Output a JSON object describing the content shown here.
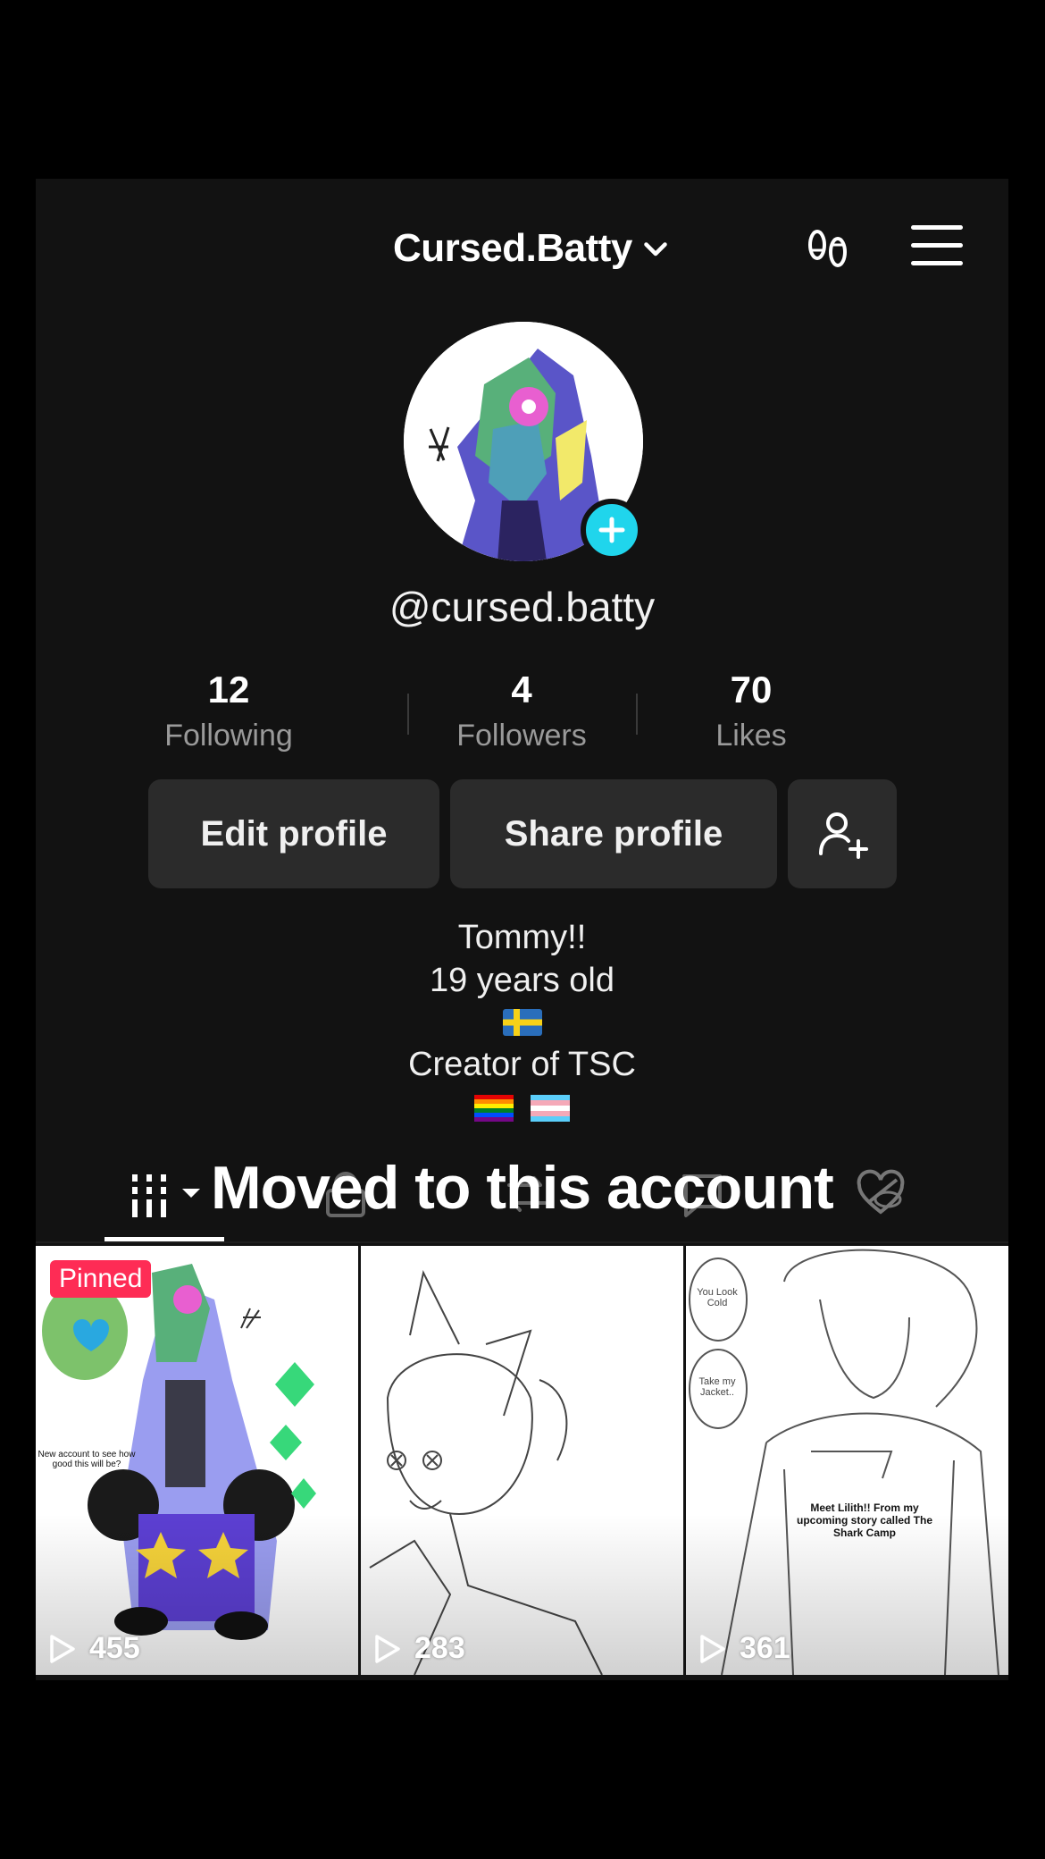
{
  "header": {
    "title": "Cursed.Batty",
    "chevron_icon": "chevron-down-icon",
    "footprint_icon": "footprints-icon",
    "menu_icon": "hamburger-menu-icon"
  },
  "profile": {
    "handle": "@cursed.batty",
    "add_badge_icon": "plus-icon",
    "accent_color": "#20d5ec"
  },
  "stats": [
    {
      "value": "12",
      "label": "Following"
    },
    {
      "value": "4",
      "label": "Followers"
    },
    {
      "value": "70",
      "label": "Likes"
    }
  ],
  "actions": {
    "edit_label": "Edit profile",
    "share_label": "Share profile",
    "add_friend_icon": "add-user-icon"
  },
  "bio": {
    "name": "Tommy!!",
    "age": "19 years old",
    "flag_icon": "sweden-flag",
    "line": "Creator of TSC",
    "pride_icons": [
      "rainbow-flag",
      "transgender-flag"
    ]
  },
  "tabs": {
    "icons": [
      "grid-icon",
      "lock-icon",
      "repost-icon",
      "bookmark-icon",
      "liked-hidden-icon"
    ],
    "overlay_text": "Moved to this account"
  },
  "videos": [
    {
      "views": "455",
      "pinned_label": "Pinned",
      "caption": "New account to see how good this will be?"
    },
    {
      "views": "283"
    },
    {
      "views": "361",
      "caption": "Meet Lilith!! From my upcoming story called The Shark Camp",
      "bubbles": [
        "You Look Cold",
        "Take my Jacket.."
      ]
    }
  ],
  "colors": {
    "background": "#121212",
    "button": "#2b2b2b",
    "pinned": "#fe2c55"
  }
}
